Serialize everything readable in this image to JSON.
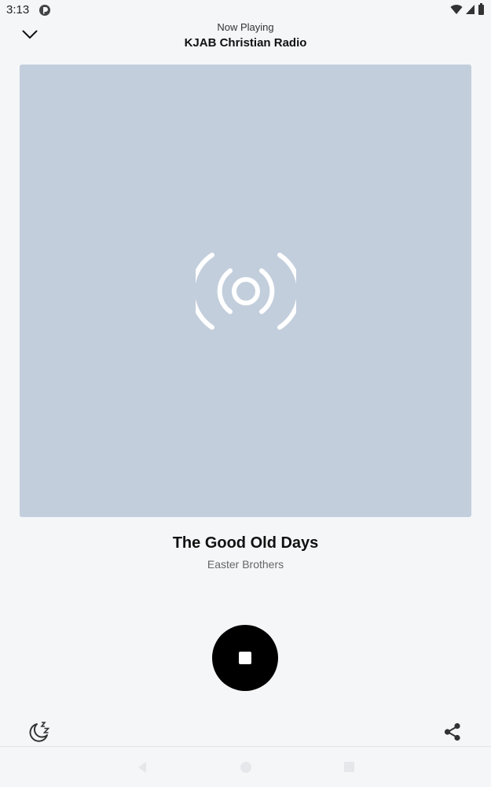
{
  "status_bar": {
    "time": "3:13",
    "icons": [
      "app-notification-icon",
      "wifi-icon",
      "signal-icon",
      "battery-icon"
    ]
  },
  "header": {
    "subtitle": "Now Playing",
    "title": "KJAB Christian Radio",
    "collapse_icon": "chevron-down-icon"
  },
  "artwork": {
    "icon": "broadcast-icon",
    "background_color": "#c3cedc"
  },
  "track": {
    "title": "The Good Old Days",
    "artist": "Easter Brothers"
  },
  "controls": {
    "play_state_icon": "stop-icon",
    "sleep_timer_icon": "sleep-timer-icon",
    "share_icon": "share-icon"
  },
  "nav_bar": {
    "icons": [
      "back-icon",
      "home-icon",
      "recents-icon"
    ]
  },
  "colors": {
    "background": "#f5f6f8",
    "primary_text": "#111111",
    "secondary_text": "#666666",
    "button": "#000000"
  }
}
